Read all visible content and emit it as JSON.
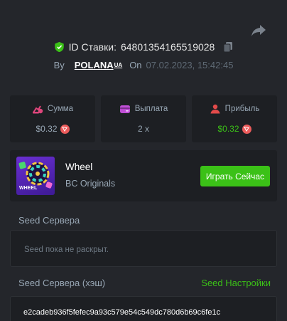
{
  "header": {
    "bet_id_label": "ID Ставки:",
    "bet_id": "64801354165519028",
    "by_label": "By",
    "username": "POLANA",
    "username_suffix": "UA",
    "on_label": "On",
    "datetime": "07.02.2023, 15:42:45"
  },
  "stats": {
    "amount": {
      "label": "Сумма",
      "value": "$0.32"
    },
    "payout": {
      "label": "Выплата",
      "value": "2 x"
    },
    "profit": {
      "label": "Прибыль",
      "value": "$0.32"
    }
  },
  "game": {
    "name": "Wheel",
    "provider": "BC Originals",
    "thumb_text": "WHEEL",
    "play_label": "Играть Сейчас"
  },
  "seed": {
    "server_label": "Seed Сервера",
    "server_value": "Seed пока не раскрыт.",
    "hash_label": "Seed Сервера (хэш)",
    "settings_link": "Seed Настройки",
    "hash_value": "e2cadeb936f5fefec9a93c579e54c549dc780d6b69c6fe1c"
  },
  "colors": {
    "background": "#24262b",
    "card": "#1d1f23",
    "accent_green": "#3bc117",
    "muted_text": "#98a7b5",
    "coin": "#eb5b5b"
  },
  "icons": [
    "share-icon",
    "shield-check-icon",
    "copy-icon",
    "money-bag-icon",
    "wallet-icon",
    "user-profit-icon",
    "trx-coin-icon"
  ]
}
